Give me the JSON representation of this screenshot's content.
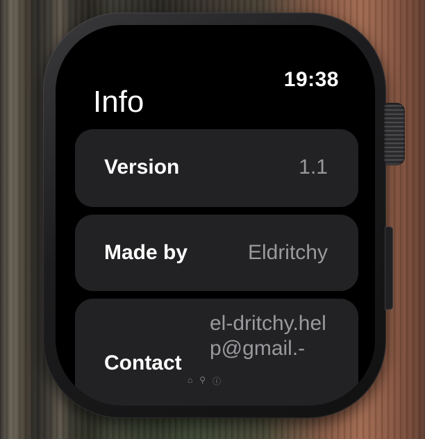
{
  "status_bar": {
    "time": "19:38"
  },
  "screen": {
    "title": "Info"
  },
  "rows": [
    {
      "label": "Version",
      "value": "1.1"
    },
    {
      "label": "Made by",
      "value": "Eldritchy"
    },
    {
      "label": "Contact",
      "value": "el-dritchy.help@gmail.-"
    }
  ],
  "indicators": {
    "home_glyph": "⌂",
    "tool_glyph": "⚲",
    "info_glyph": "ⓘ"
  },
  "icons": [
    "home-icon",
    "wrench-icon",
    "info-icon"
  ],
  "colors": {
    "screen_background": "#000000",
    "row_background": "#222224",
    "label_text": "#ffffff",
    "value_text": "#9a9a9e"
  }
}
